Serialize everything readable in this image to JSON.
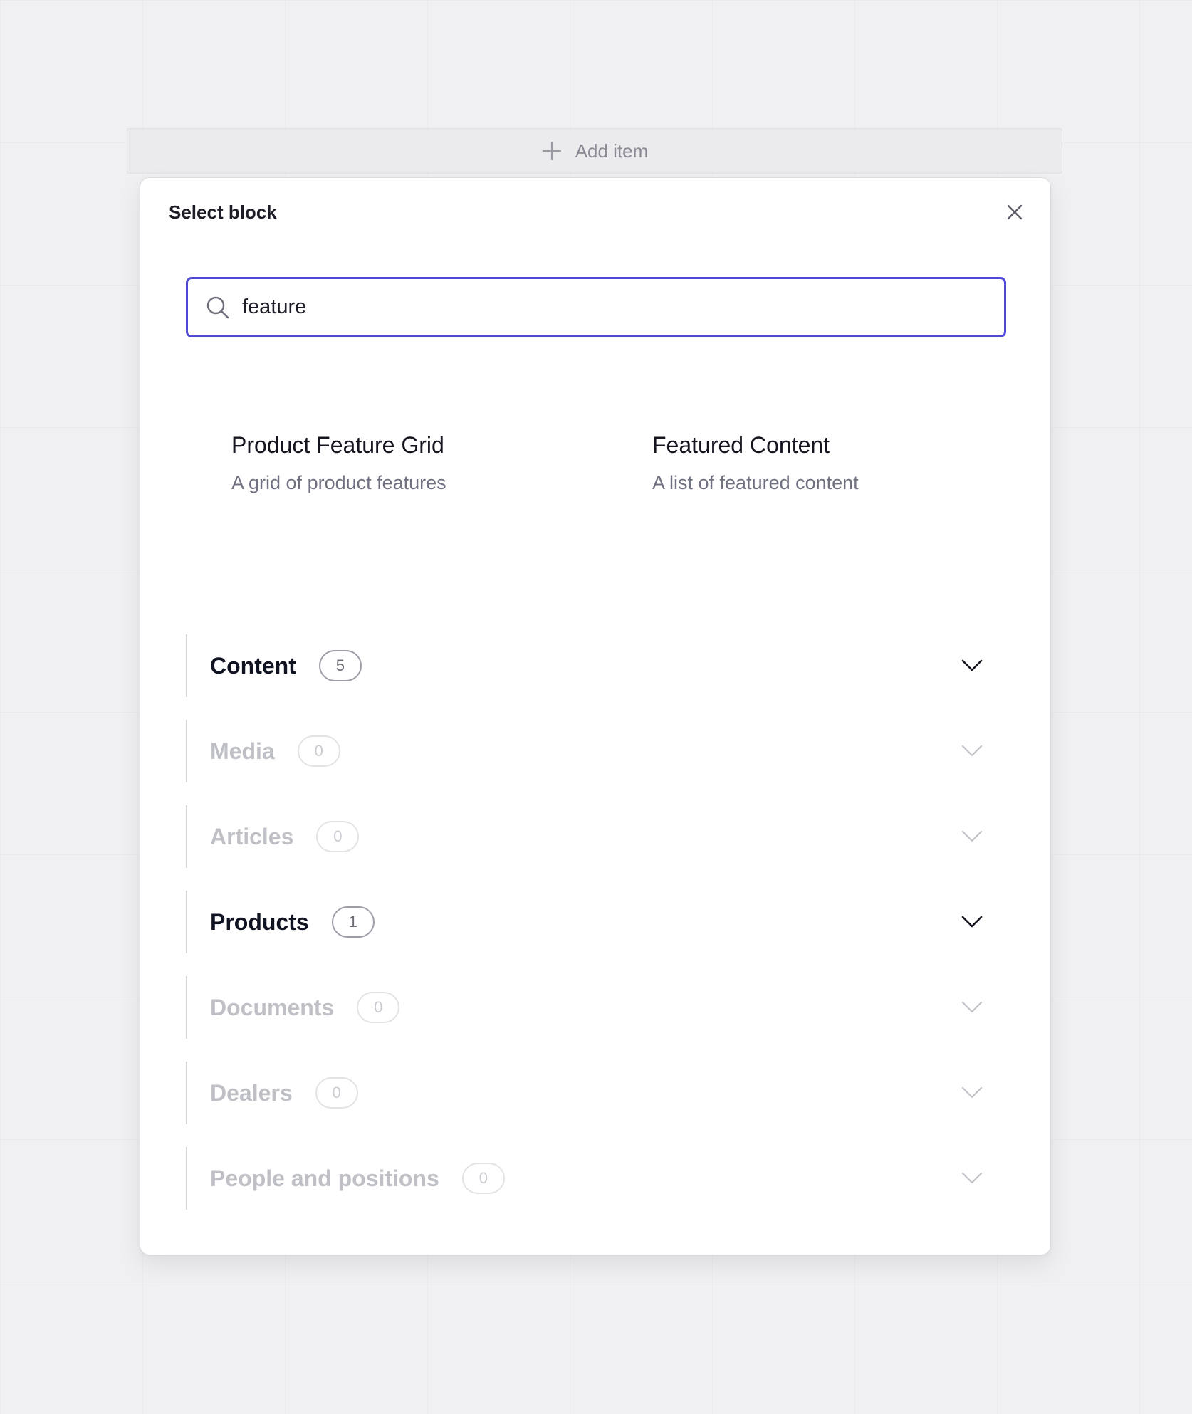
{
  "add_item": {
    "label": "Add item",
    "icon": "plus-icon"
  },
  "modal": {
    "title": "Select block",
    "close_icon": "close-icon"
  },
  "search": {
    "value": "feature",
    "placeholder": "",
    "icon": "search-icon",
    "accent_color": "#5049d1"
  },
  "results": [
    {
      "title": "Product Feature Grid",
      "description": "A grid of product features"
    },
    {
      "title": "Featured Content",
      "description": "A list of featured content"
    }
  ],
  "categories": [
    {
      "label": "Content",
      "count": "5",
      "state": "active"
    },
    {
      "label": "Media",
      "count": "0",
      "state": "inactive"
    },
    {
      "label": "Articles",
      "count": "0",
      "state": "inactive"
    },
    {
      "label": "Products",
      "count": "1",
      "state": "active"
    },
    {
      "label": "Documents",
      "count": "0",
      "state": "inactive"
    },
    {
      "label": "Dealers",
      "count": "0",
      "state": "inactive"
    },
    {
      "label": "People and positions",
      "count": "0",
      "state": "inactive"
    }
  ],
  "colors": {
    "active_text": "#101322",
    "inactive_text": "#bfc0c6"
  }
}
